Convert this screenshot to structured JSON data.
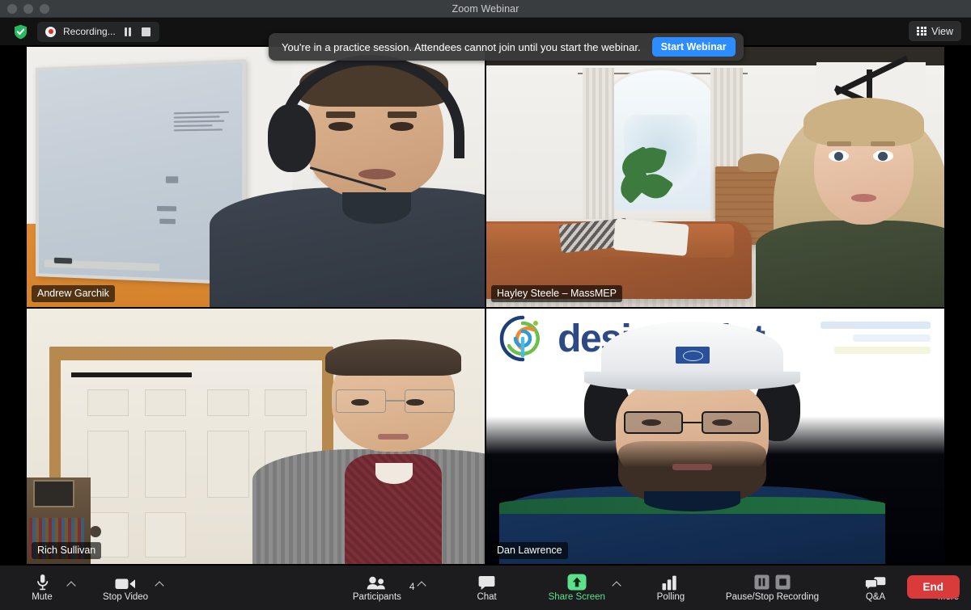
{
  "window": {
    "title": "Zoom Webinar",
    "traffic_lights": [
      "close",
      "minimize",
      "maximize"
    ]
  },
  "topbar": {
    "encryption_icon": "shield-check-icon",
    "recording": {
      "icon": "record-dot-icon",
      "label": "Recording...",
      "pause_icon": "pause-icon",
      "stop_icon": "stop-icon"
    },
    "view": {
      "icon": "grid-icon",
      "label": "View"
    }
  },
  "banner": {
    "message": "You're in a practice session. Attendees cannot join until you start the webinar.",
    "button_label": "Start Webinar",
    "button_color": "#2d8cff"
  },
  "grid": {
    "active_speaker_border": "#d8ec4e",
    "tiles": [
      {
        "name": "Andrew Garchik",
        "active": true,
        "scene": "office-whiteboard"
      },
      {
        "name": "Hayley Steele – MassMEP",
        "active": false,
        "scene": "living-room-virtual-background"
      },
      {
        "name": "Rich Sullivan",
        "active": false,
        "scene": "home-door"
      },
      {
        "name": "Dan Lawrence",
        "active": false,
        "scene": "designpoint-slide"
      }
    ]
  },
  "slide": {
    "logo_text": "designpoint",
    "logo_color": "#2c4a86"
  },
  "toolbar": {
    "mute": {
      "label": "Mute",
      "icon": "microphone-icon",
      "has_caret": true
    },
    "video": {
      "label": "Stop Video",
      "icon": "camera-icon",
      "has_caret": true
    },
    "participants": {
      "label": "Participants",
      "icon": "participants-icon",
      "count": "4",
      "has_caret": true
    },
    "chat": {
      "label": "Chat",
      "icon": "chat-bubble-icon"
    },
    "share": {
      "label": "Share Screen",
      "icon": "share-up-arrow-icon",
      "has_caret": true,
      "color": "#5ce08a"
    },
    "polling": {
      "label": "Polling",
      "icon": "bar-chart-icon"
    },
    "recording": {
      "label": "Pause/Stop Recording",
      "pause_icon": "pause-icon",
      "stop_icon": "stop-icon"
    },
    "qa": {
      "label": "Q&A",
      "icon": "qa-bubbles-icon"
    },
    "more": {
      "label": "More",
      "icon": "ellipsis-icon"
    },
    "end": {
      "label": "End",
      "color": "#d93b3b"
    }
  }
}
